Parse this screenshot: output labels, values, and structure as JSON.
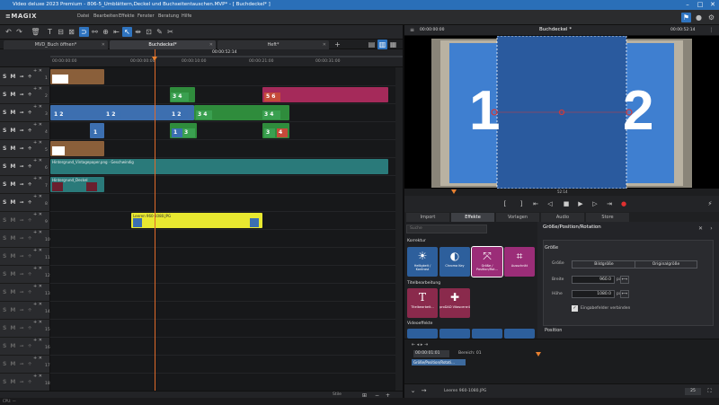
{
  "window": {
    "title": "Video deluxe 2023 Premium - 806-5_Umblättern,Deckel und Buchseitentauschen.MVP* - [ Buchdeckel* ]"
  },
  "menu": {
    "logo": "≡MAGIX",
    "items": [
      "Datei",
      "Bearbeiten",
      "Effekte",
      "Fenster",
      "Beratung",
      "Hilfe"
    ]
  },
  "tabs": [
    {
      "label": "MVD_Buch öffnen*"
    },
    {
      "label": "Buchdeckel*"
    },
    {
      "label": "Heft*"
    }
  ],
  "ruler": {
    "timecode": "00:00:52:14",
    "labels": [
      "00:00:00:00",
      "00:00:00:00",
      "00:00:10:00",
      "00:00:21:00",
      "00:00:31:00"
    ]
  },
  "tracks": [
    "1",
    "2",
    "3",
    "4",
    "5",
    "6",
    "7",
    "8",
    "9",
    "10",
    "11",
    "12",
    "13",
    "14",
    "15",
    "16",
    "17",
    "18"
  ],
  "track_controls": {
    "smc": "S M ⊸ ÷",
    "ctl": "+ ✕"
  },
  "clips": {
    "c6": "Hintergrund_Vintagepaper.png · Geschwindig",
    "c7": "Hintergrund_Deckel",
    "c9": "Leeren 960-1080.JPG",
    "thumb1": "1 2",
    "thumb2": "3 4",
    "thumb3": "5 6",
    "thumb4": "1",
    "thumb5": "3",
    "thumb6": "4"
  },
  "status": {
    "cpu": "CPU: —",
    "zoom": "Stile"
  },
  "monitor": {
    "timecode_left": "00:00:00:00",
    "title": "Buchdeckel *",
    "timecode_right": "00:00:52:14",
    "ruler_tc": "52:14",
    "big_left": "1",
    "big_right": "2",
    "accent_marker": "#e03030"
  },
  "media_tabs": [
    "Import",
    "Effekte",
    "Vorlagen",
    "Audio",
    "Store"
  ],
  "effects": {
    "search_placeholder": "Suche",
    "section1": "Korrektur",
    "items1": [
      {
        "label": "Helligkeit / Kontrast",
        "icon": "sun-icon"
      },
      {
        "label": "Chroma Key",
        "icon": "chroma-icon"
      },
      {
        "label": "Größe / Position/Rot...",
        "icon": "resize-icon"
      },
      {
        "label": "Ausschnitt",
        "icon": "crop-icon"
      }
    ],
    "section2": "Titelbearbeitung",
    "items2": [
      {
        "label": "Titelbearbeit...",
        "icon": "T-icon"
      },
      {
        "label": "proDAD Vitascene4",
        "icon": "puzzle-icon"
      }
    ],
    "section3": "Videoeffekte"
  },
  "props": {
    "title": "Größe/Position/Rotation",
    "group1": "Größe",
    "size_label": "Größe",
    "btn_fill": "Bildgröße",
    "btn_orig": "Originalgröße",
    "width_label": "Breite",
    "width_value": "960.0",
    "unit": "px",
    "height_label": "Höhe",
    "height_value": "1080.0",
    "link_label": "Eingabefelder verbinden",
    "group2": "Position"
  },
  "keyframes": {
    "tc": "00:00:01:01",
    "label": "Bereich: 01",
    "item": "Größe/Position/Rotati...",
    "file": "Leeren 960-1080.JPG",
    "zoom": "25"
  }
}
